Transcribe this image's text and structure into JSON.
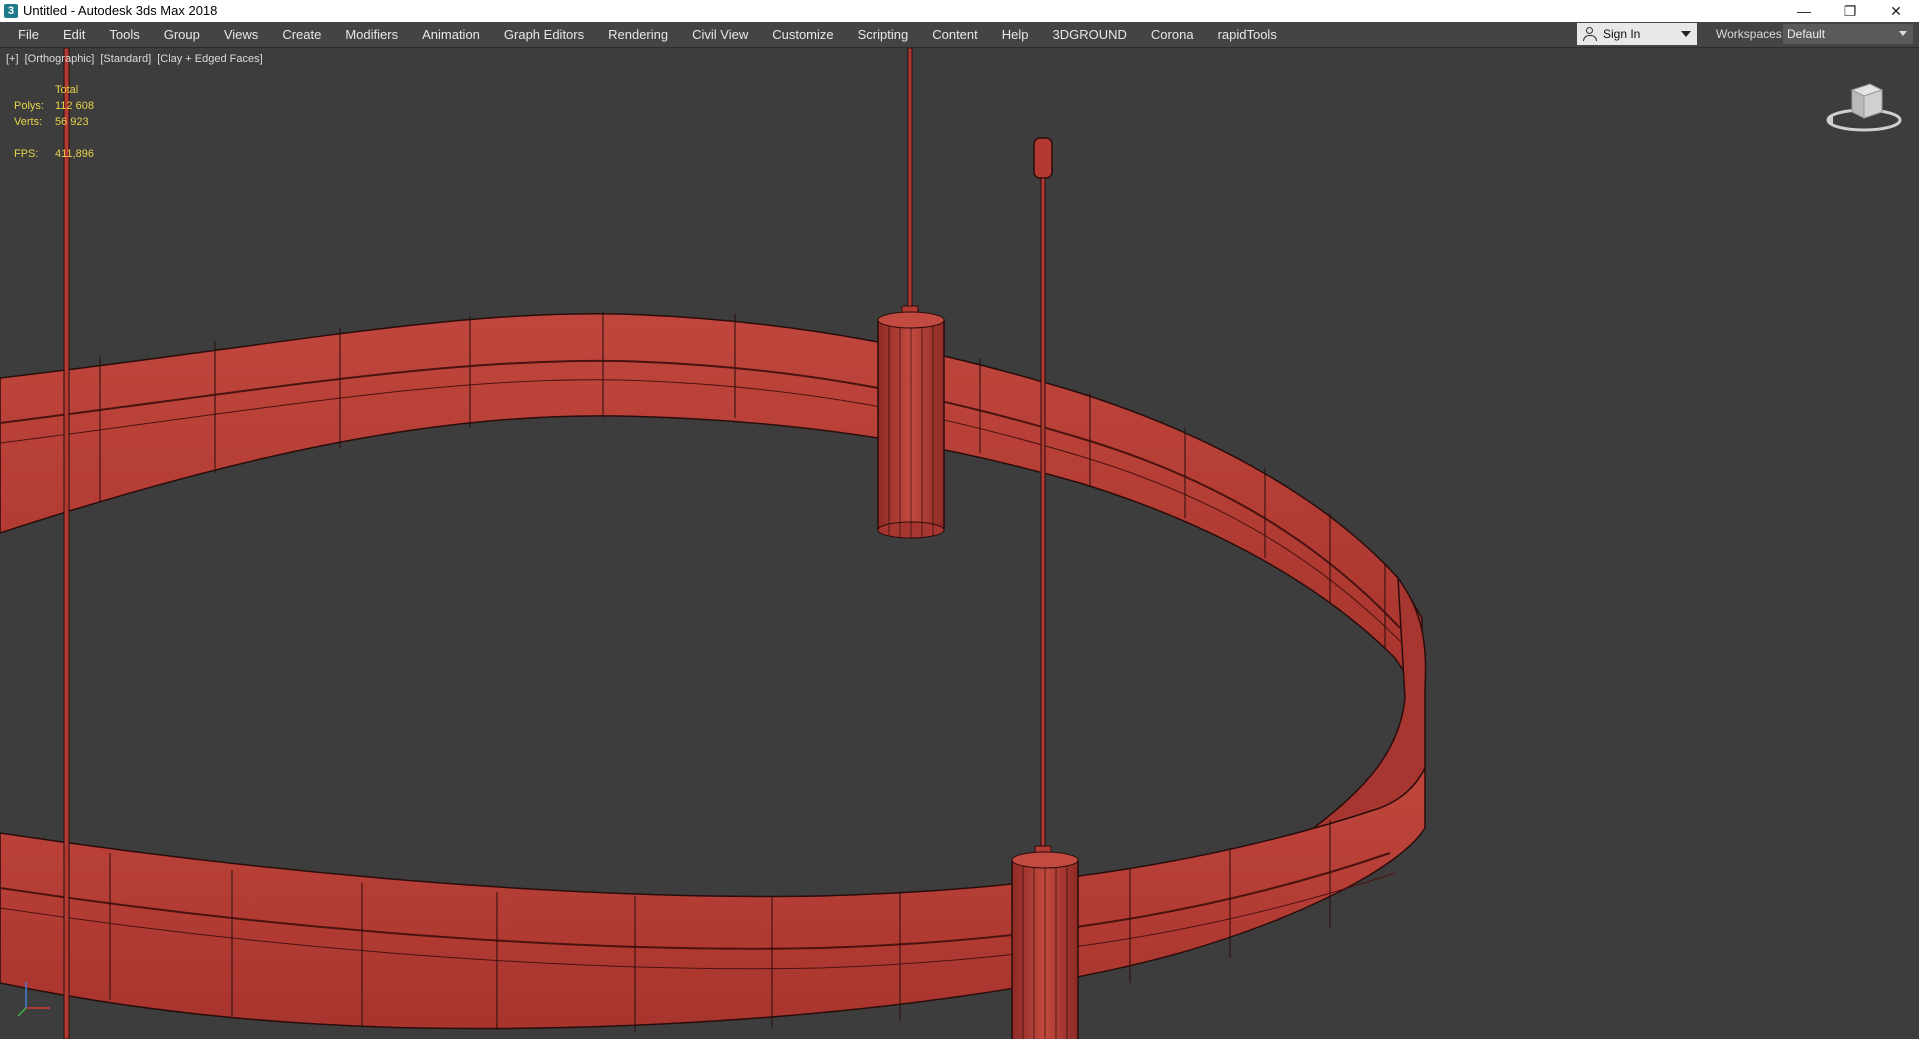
{
  "window": {
    "title": "Untitled - Autodesk 3ds Max 2018",
    "app_icon_glyph": "3",
    "controls": [
      "minimize-icon",
      "restore-icon",
      "close-icon"
    ]
  },
  "menubar": {
    "items": [
      "File",
      "Edit",
      "Tools",
      "Group",
      "Views",
      "Create",
      "Modifiers",
      "Animation",
      "Graph Editors",
      "Rendering",
      "Civil View",
      "Customize",
      "Scripting",
      "Content",
      "Help",
      "3DGROUND",
      "Corona",
      "rapidTools"
    ],
    "signin_label": "Sign In",
    "workspaces_label": "Workspaces:",
    "workspaces_value": "Default"
  },
  "viewport": {
    "label_parts": [
      "[+]",
      "[Orthographic]",
      "[Standard]",
      "[Clay + Edged Faces]"
    ],
    "stats": {
      "header": "Total",
      "polys_label": "Polys:",
      "polys_value": "112 608",
      "verts_label": "Verts:",
      "verts_value": "56 923",
      "fps_label": "FPS:",
      "fps_value": "411,896"
    },
    "model_color": "#b33a32",
    "edge_color": "#2a0d0b",
    "background_color": "#3d3d3d",
    "stats_color": "#e7d34a"
  }
}
